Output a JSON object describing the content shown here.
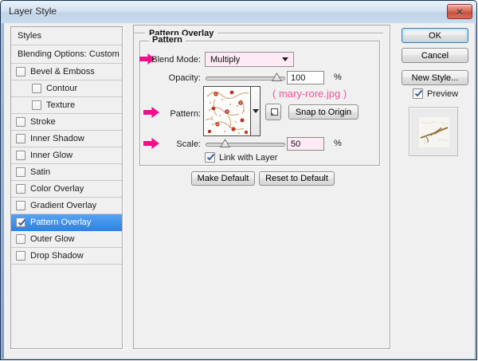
{
  "window": {
    "title": "Layer Style",
    "close_glyph": "✕"
  },
  "sidebar": {
    "items": [
      {
        "label": "Styles"
      },
      {
        "label": "Blending Options: Custom"
      },
      {
        "label": "Bevel & Emboss",
        "checked": false
      },
      {
        "label": "Contour",
        "checked": false
      },
      {
        "label": "Texture",
        "checked": false
      },
      {
        "label": "Stroke",
        "checked": false
      },
      {
        "label": "Inner Shadow",
        "checked": false
      },
      {
        "label": "Inner Glow",
        "checked": false
      },
      {
        "label": "Satin",
        "checked": false
      },
      {
        "label": "Color Overlay",
        "checked": false
      },
      {
        "label": "Gradient Overlay",
        "checked": false
      },
      {
        "label": "Pattern Overlay",
        "checked": true,
        "selected": true
      },
      {
        "label": "Outer Glow",
        "checked": false
      },
      {
        "label": "Drop Shadow",
        "checked": false
      }
    ]
  },
  "main": {
    "section_title": "Pattern Overlay",
    "group_title": "Pattern",
    "blend_mode": {
      "label": "Blend Mode:",
      "value": "Multiply"
    },
    "opacity": {
      "label": "Opacity:",
      "value": "100",
      "unit": "%"
    },
    "pattern": {
      "label": "Pattern:",
      "annotation": "( mary-rore.jpg )",
      "snap_button": "Snap to Origin"
    },
    "scale": {
      "label": "Scale:",
      "value": "50",
      "unit": "%"
    },
    "link_checkbox_label": "Link with Layer",
    "make_default_label": "Make Default",
    "reset_default_label": "Reset to Default"
  },
  "actions": {
    "ok": "OK",
    "cancel": "Cancel",
    "new_style": "New Style...",
    "preview_label": "Preview"
  },
  "colors": {
    "accent_pink": "#f0108a",
    "annotation_pink": "#f4549c",
    "highlight_field_pink": "#fdeaf5",
    "selection_blue": "#3d96f3"
  }
}
